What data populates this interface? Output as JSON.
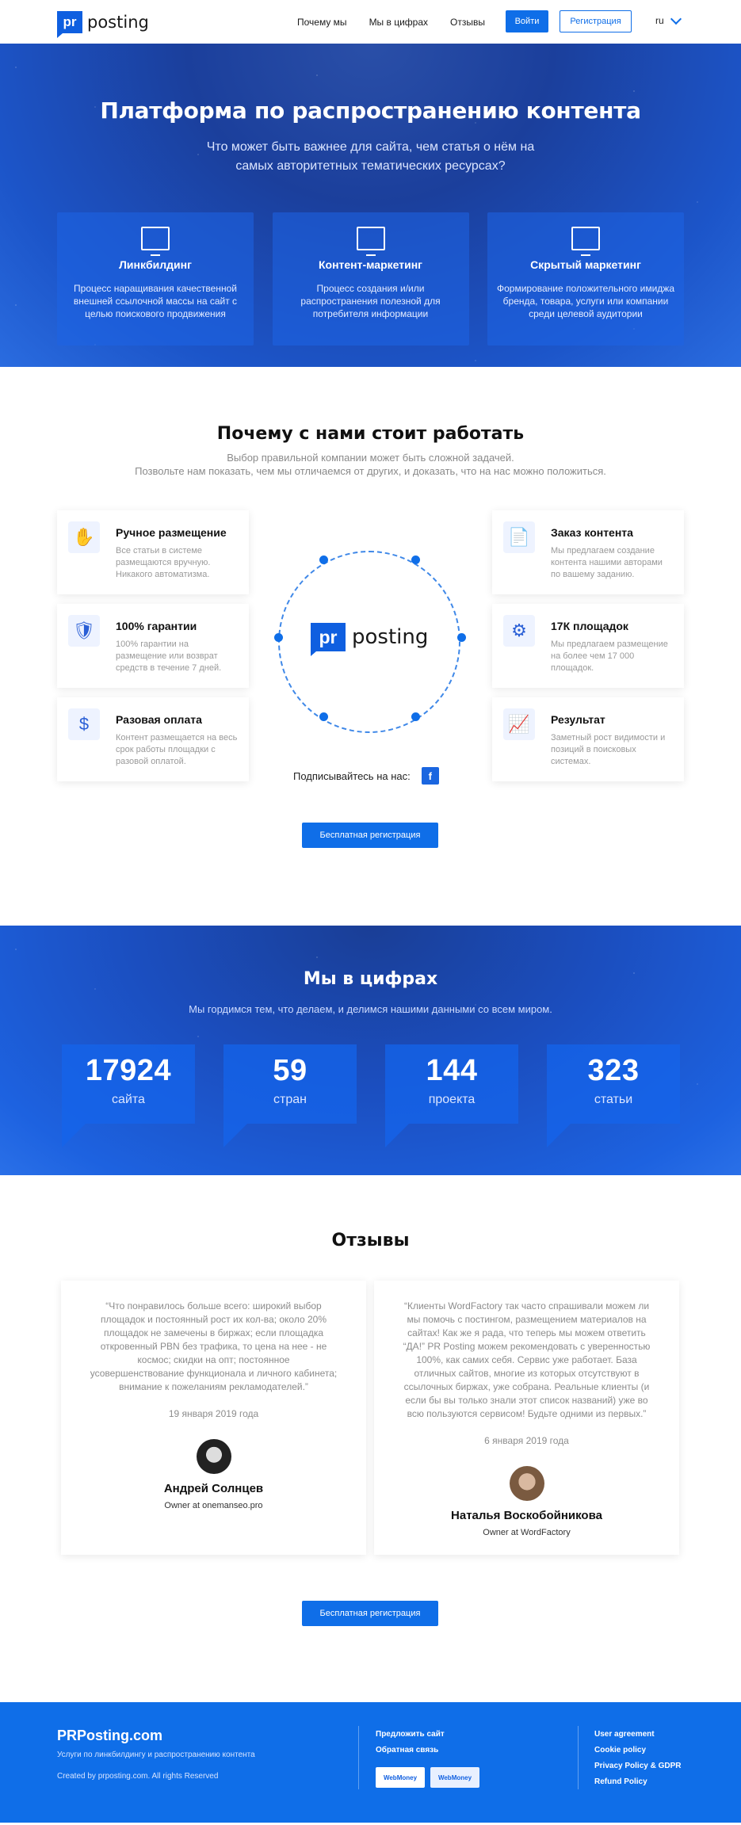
{
  "header": {
    "logo_mark": "pr",
    "logo_text": "posting",
    "nav": [
      "Почему мы",
      "Мы в цифрах",
      "Отзывы"
    ],
    "login": "Войти",
    "register": "Регистрация",
    "lang": "ru"
  },
  "hero": {
    "title": "Платформа по распространению контента",
    "subtitle": "Что может быть важнее для сайта, чем статья о нём на самых авторитетных тематических ресурсах?",
    "cards": [
      {
        "icon": "link-monitor-icon",
        "title": "Линкбилдинг",
        "text": "Процесс наращивания качественной внешней ссылочной массы на сайт с целью поискового продвижения"
      },
      {
        "icon": "content-monitor-icon",
        "title": "Контент-маркетинг",
        "text": "Процесс создания и/или распространения полезной для потребителя информации"
      },
      {
        "icon": "star-monitor-icon",
        "title": "Скрытый маркетинг",
        "text": "Формирование положительного имиджа бренда, товара, услуги или компании среди целевой аудитории"
      }
    ]
  },
  "why": {
    "title": "Почему с нами стоит работать",
    "subtitle_line1": "Выбор правильной компании может быть сложной задачей.",
    "subtitle_line2": "Позвольте нам показать, чем мы отличаемся от других, и доказать, что на нас можно положиться.",
    "features": [
      {
        "icon": "hand-icon",
        "glyph": "✋",
        "title": "Ручное размещение",
        "text": "Все статьи в системе размещаются вручную. Никакого автоматизма."
      },
      {
        "icon": "shield-check-icon",
        "glyph": "🛡",
        "title": "100% гарантии",
        "text": "100% гарантии на размещение или возврат средств в течение 7 дней."
      },
      {
        "icon": "money-bag-icon",
        "glyph": "$",
        "title": "Разовая оплата",
        "text": "Контент размещается на весь срок работы площадки с разовой оплатой."
      },
      {
        "icon": "document-icon",
        "glyph": "📄",
        "title": "Заказ контента",
        "text": "Мы предлагаем создание контента нашими авторами по вашему заданию."
      },
      {
        "icon": "network-icon",
        "glyph": "⚙",
        "title": "17К площадок",
        "text": "Мы предлагаем размещение на более чем 17 000 площадок."
      },
      {
        "icon": "growth-chart-icon",
        "glyph": "📈",
        "title": "Результат",
        "text": "Заметный рост видимости и позиций в поисковых системах."
      }
    ],
    "subscribe": "Подписывайтесь на нас:",
    "fb": "f",
    "cta": "Бесплатная регистрация"
  },
  "stats": {
    "title": "Мы в цифрах",
    "subtitle": "Мы гордимся тем, что делаем, и делимся нашими данными со всем миром.",
    "items": [
      {
        "num": "17924",
        "label": "сайта"
      },
      {
        "num": "59",
        "label": "стран"
      },
      {
        "num": "144",
        "label": "проекта"
      },
      {
        "num": "323",
        "label": "статьи"
      }
    ]
  },
  "reviews": {
    "title": "Отзывы",
    "items": [
      {
        "text": "“Что понравилось больше всего: широкий выбор площадок и постоянный рост их кол-ва; около 20% площадок не замечены в биржах; если площадка откровенный PBN без трафика, то цена на нее - не космос; скидки на опт; постоянное усовершенствование функционала и личного кабинета; внимание к пожеланиям рекламодателей.”",
        "date": "19 января 2019 года",
        "name": "Андрей Солнцев",
        "role": "Owner at onemanseo.pro"
      },
      {
        "text": "“Клиенты WordFactory так часто спрашивали можем ли мы помочь с постингом, размещением материалов на сайтах! Как же я рада, что теперь мы можем ответить “ДА!” PR Posting можем рекомендовать с уверенностью 100%, как самих себя. Сервис уже работает. База отличных сайтов, многие из которых отсутствуют в ссылочных биржах, уже собрана. Реальные клиенты (и если бы вы только знали этот список названий) уже во всю пользуются сервисом! Будьте одними из первых.”",
        "date": "6 января 2019 года",
        "name": "Наталья Воскобойникова",
        "role": "Owner at WordFactory"
      }
    ],
    "cta": "Бесплатная регистрация"
  },
  "footer": {
    "brand": "PRPosting.com",
    "desc": "Услуги по линкбилдингу и распространению контента",
    "copy": "Created by prposting.com. All rights Reserved",
    "mid_links": [
      "Предложить сайт",
      "Обратная связь"
    ],
    "right_links": [
      "User agreement",
      "Cookie policy",
      "Privacy Policy & GDPR",
      "Refund Policy"
    ],
    "wm1": "WebMoney",
    "wm2": "WebMoney"
  }
}
